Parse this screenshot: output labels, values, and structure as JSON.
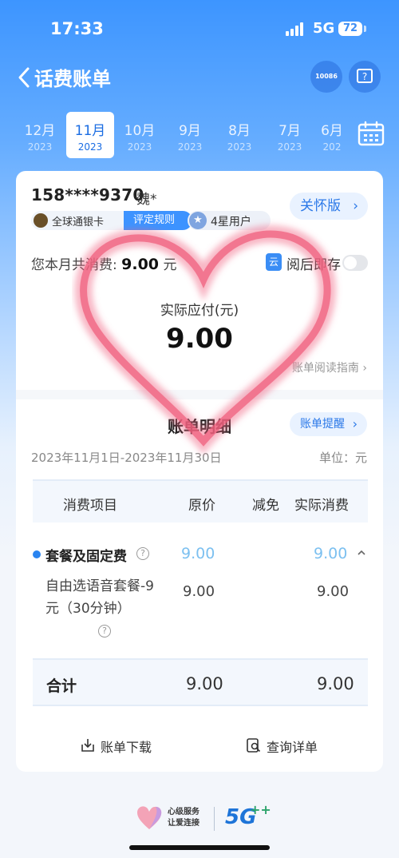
{
  "status_bar": {
    "time": "17:33",
    "network": "5G",
    "battery": "72"
  },
  "nav": {
    "title": "话费账单",
    "service_number": "10086"
  },
  "months": [
    {
      "month": "12月",
      "year": "2023",
      "active": false
    },
    {
      "month": "11月",
      "year": "2023",
      "active": true
    },
    {
      "month": "10月",
      "year": "2023",
      "active": false
    },
    {
      "month": "9月",
      "year": "2023",
      "active": false
    },
    {
      "month": "8月",
      "year": "2023",
      "active": false
    },
    {
      "month": "7月",
      "year": "2023",
      "active": false
    },
    {
      "month": "6月",
      "year": "202",
      "active": false
    }
  ],
  "account": {
    "phone": "158****9370",
    "name": "魏*",
    "care_mode": "关怀版",
    "card_badge": "全球通银卡",
    "rule_link": "评定规则",
    "star_badge": "4星用户"
  },
  "summary": {
    "consume_prefix": "您本月共消费:",
    "consume_amount": "9.00",
    "consume_unit": "元",
    "read_save": "阅后即存",
    "read_save_icon": "云",
    "read_save_enabled": false,
    "pay_label": "实际应付(元)",
    "pay_amount": "9.00",
    "guide": "账单阅读指南"
  },
  "detail": {
    "title": "账单明细",
    "remind": "账单提醒",
    "period": "2023年11月1日-2023年11月30日",
    "unit": "单位：元",
    "headers": [
      "消费项目",
      "原价",
      "减免",
      "实际消费"
    ],
    "main_row": {
      "name": "套餐及固定费",
      "original": "9.00",
      "actual": "9.00"
    },
    "sub_row": {
      "name": "自由选语音套餐-9元（30分钟）",
      "original": "9.00",
      "actual": "9.00"
    },
    "total": {
      "label": "合计",
      "original": "9.00",
      "actual": "9.00"
    }
  },
  "actions": {
    "download": "账单下载",
    "query": "查询详单"
  },
  "footer": {
    "slogan_line1": "心级服务",
    "slogan_line2": "让爱连接",
    "logo_5g": "5G",
    "logo_plus": "++"
  },
  "colors": {
    "accent": "#2a78e8",
    "header_blue": "#3d95ff",
    "value_light_blue": "#7cc0f0",
    "heart_pink": "#f0607e"
  }
}
